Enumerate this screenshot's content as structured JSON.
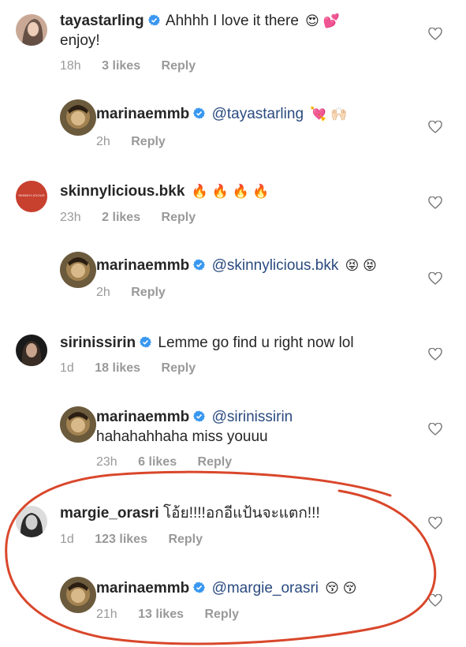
{
  "comments": [
    {
      "user": "tayastarling",
      "text": "Ahhhh I love it there",
      "emoji": "😍 💕",
      "text2": "enjoy!",
      "time": "18h",
      "likes": "3 likes",
      "reply": "Reply"
    },
    {
      "user": "marinaemmb",
      "mention": "@tayastarling",
      "emoji": "💘 🙌🏻",
      "time": "2h",
      "reply": "Reply"
    },
    {
      "user": "skinnylicious.bkk",
      "emoji": "🔥 🔥 🔥 🔥",
      "time": "23h",
      "likes": "2 likes",
      "reply": "Reply",
      "avatar_text": "SKINNYLICIOUS"
    },
    {
      "user": "marinaemmb",
      "mention": "@skinnylicious.bkk",
      "emoji": "😝 😝",
      "time": "2h",
      "reply": "Reply"
    },
    {
      "user": "sirinissirin",
      "text": "Lemme go find u right now lol",
      "time": "1d",
      "likes": "18 likes",
      "reply": "Reply"
    },
    {
      "user": "marinaemmb",
      "mention": "@sirinissirin",
      "text2": "hahahahhaha miss youuu",
      "time": "23h",
      "likes": "6 likes",
      "reply": "Reply"
    },
    {
      "user": "margie_orasri",
      "text": "โอ้ย!!!!อกอีแป้นจะแตก!!!",
      "time": "1d",
      "likes": "123 likes",
      "reply": "Reply"
    },
    {
      "user": "marinaemmb",
      "mention": "@margie_orasri",
      "emoji": "😚 😚",
      "time": "21h",
      "likes": "13 likes",
      "reply": "Reply"
    }
  ],
  "colors": {
    "verified": "#3897f0",
    "mention": "#2a4a7f",
    "meta": "#999999",
    "annotation": "#d9472b"
  }
}
